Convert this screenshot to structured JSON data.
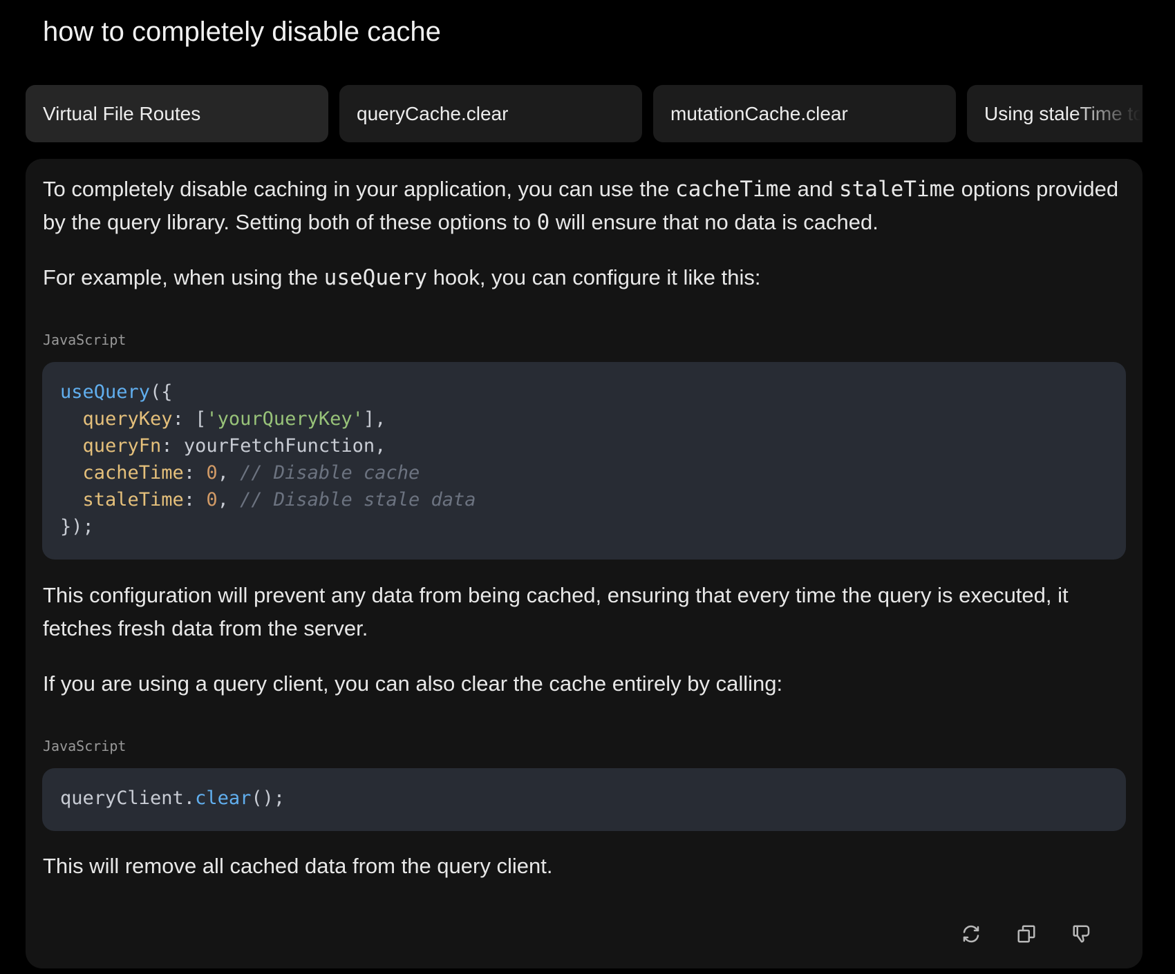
{
  "question": "how to completely disable cache",
  "chips": [
    {
      "label": "Virtual File Routes"
    },
    {
      "label": "queryCache.clear"
    },
    {
      "label": "mutationCache.clear"
    },
    {
      "label": "Using staleTime to"
    }
  ],
  "answer": {
    "p1": {
      "a": "To completely disable caching in your application, you can use the ",
      "code1": "cacheTime",
      "b": " and ",
      "code2": "staleTime",
      "c": " options provided by the query library. Setting both of these options to ",
      "code3": "0",
      "d": " will ensure that no data is cached."
    },
    "p2": {
      "a": "For example, when using the ",
      "code1": "useQuery",
      "b": " hook, you can configure it like this:"
    },
    "code_block_1": {
      "language": "JavaScript",
      "fn": "useQuery",
      "open": "({",
      "k1": "queryKey",
      "colon": ": ",
      "bracket_open": "[",
      "s1": "'yourQueryKey'",
      "bracket_close": "],",
      "k2": "queryFn",
      "v2": "yourFetchFunction,",
      "k3": "cacheTime",
      "n3": "0",
      "comma": ",",
      "c3": "// Disable cache",
      "k4": "staleTime",
      "n4": "0",
      "c4": "// Disable stale data",
      "close": "});"
    },
    "p3": "This configuration will prevent any data from being cached, ensuring that every time the query is executed, it fetches fresh data from the server.",
    "p4": "If you are using a query client, you can also clear the cache entirely by calling:",
    "code_block_2": {
      "language": "JavaScript",
      "obj": "queryClient.",
      "fn": "clear",
      "tail": "();"
    },
    "p5": "This will remove all cached data from the query client."
  },
  "actions": {
    "icons": [
      "refresh-icon",
      "copy-icon",
      "thumbs-down-icon"
    ]
  }
}
